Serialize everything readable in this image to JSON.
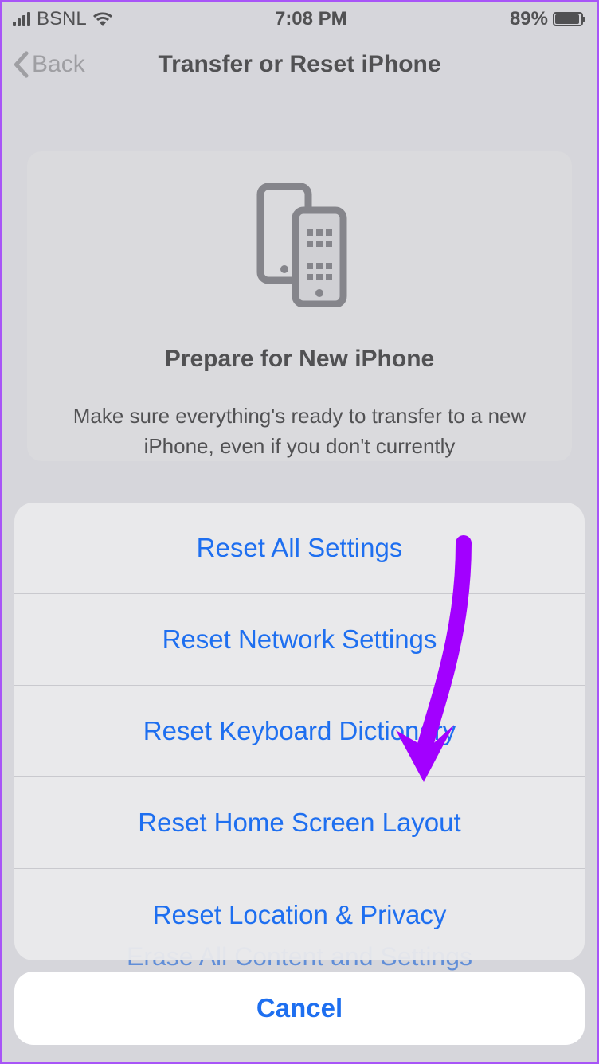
{
  "status_bar": {
    "carrier": "BSNL",
    "time": "7:08 PM",
    "battery_percent": "89%",
    "battery_fill_width": "89%"
  },
  "nav": {
    "back_label": "Back",
    "title": "Transfer or Reset iPhone"
  },
  "card": {
    "title": "Prepare for New iPhone",
    "description": "Make sure everything's ready to transfer to a new iPhone, even if you don't currently"
  },
  "background_row": {
    "label": "Erase All Content and Settings"
  },
  "sheet": {
    "options": [
      "Reset All Settings",
      "Reset Network Settings",
      "Reset Keyboard Dictionary",
      "Reset Home Screen Layout",
      "Reset Location & Privacy"
    ],
    "cancel_label": "Cancel"
  },
  "annotation": {
    "arrow_color": "#a200ff"
  }
}
